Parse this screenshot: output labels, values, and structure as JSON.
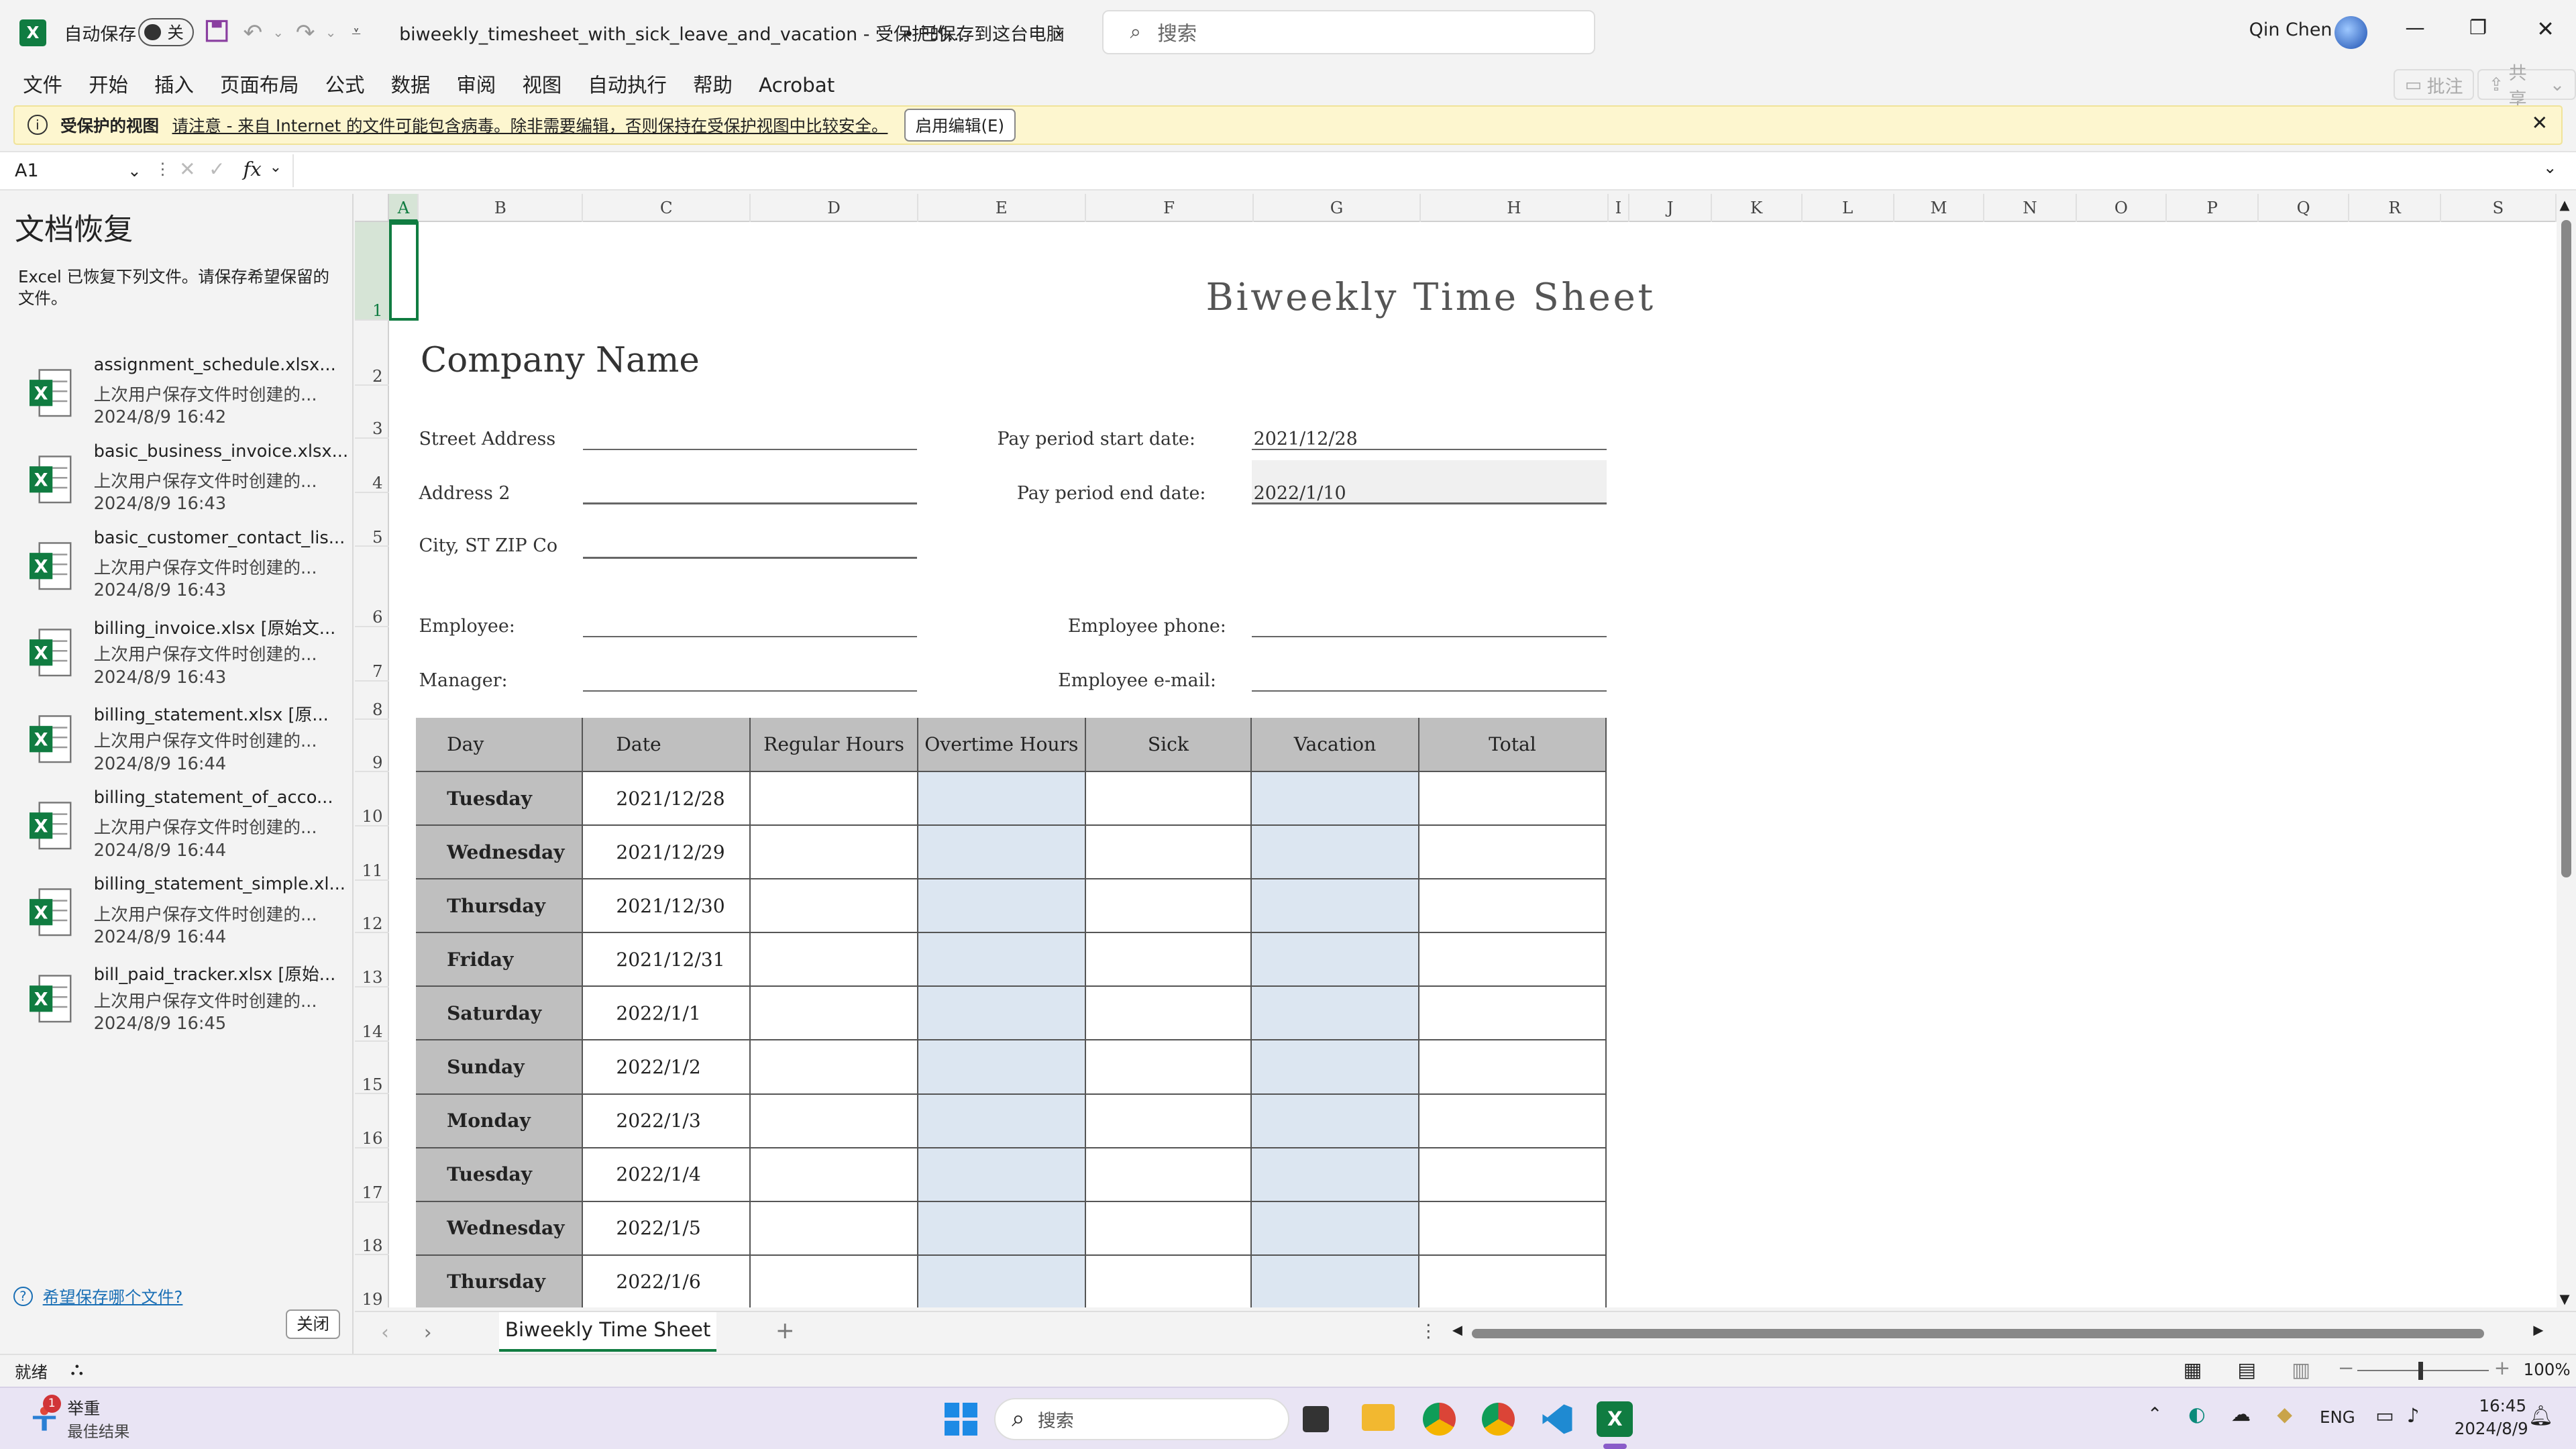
{
  "titlebar": {
    "autosave_label": "自动保存",
    "autosave_state": "关",
    "doc_title": "biweekly_timesheet_with_sick_leave_and_vacation  -  受保护的...",
    "save_status": "• 已保存到这台电脑",
    "search_placeholder": "搜索",
    "user_name": "Qin Chen"
  },
  "menu": {
    "items": [
      "文件",
      "开始",
      "插入",
      "页面布局",
      "公式",
      "数据",
      "审阅",
      "视图",
      "自动执行",
      "帮助",
      "Acrobat"
    ],
    "comments": "批注",
    "share": "共享"
  },
  "protected": {
    "label": "受保护的视图",
    "message": "请注意 - 来自 Internet 的文件可能包含病毒。除非需要编辑，否则保持在受保护视图中比较安全。",
    "enable_button": "启用编辑(E)"
  },
  "formula_bar": {
    "name_box": "A1",
    "fx": "fx",
    "formula": ""
  },
  "recovery": {
    "title": "文档恢复",
    "description": "Excel 已恢复下列文件。请保存希望保留的文件。",
    "files": [
      {
        "name": "assignment_schedule.xlsx...",
        "desc": "上次用户保存文件时创建的...",
        "time": "2024/8/9 16:42"
      },
      {
        "name": "basic_business_invoice.xlsx...",
        "desc": "上次用户保存文件时创建的...",
        "time": "2024/8/9 16:43"
      },
      {
        "name": "basic_customer_contact_lis...",
        "desc": "上次用户保存文件时创建的...",
        "time": "2024/8/9 16:43"
      },
      {
        "name": "billing_invoice.xlsx  [原始文...",
        "desc": "上次用户保存文件时创建的...",
        "time": "2024/8/9 16:43"
      },
      {
        "name": "billing_statement.xlsx  [原...",
        "desc": "上次用户保存文件时创建的...",
        "time": "2024/8/9 16:44"
      },
      {
        "name": "billing_statement_of_acco...",
        "desc": "上次用户保存文件时创建的...",
        "time": "2024/8/9 16:44"
      },
      {
        "name": "billing_statement_simple.xl...",
        "desc": "上次用户保存文件时创建的...",
        "time": "2024/8/9 16:44"
      },
      {
        "name": "bill_paid_tracker.xlsx  [原始...",
        "desc": "上次用户保存文件时创建的...",
        "time": "2024/8/9 16:45"
      }
    ],
    "help_link": "希望保存哪个文件?",
    "close_button": "关闭"
  },
  "columns": [
    "A",
    "B",
    "C",
    "D",
    "E",
    "F",
    "G",
    "H",
    "I",
    "J",
    "K",
    "L",
    "M",
    "N",
    "O",
    "P",
    "Q",
    "R",
    "S"
  ],
  "rows": [
    "1",
    "2",
    "3",
    "4",
    "5",
    "6",
    "7",
    "8",
    "9",
    "10",
    "11",
    "12",
    "13",
    "14",
    "15",
    "16",
    "17",
    "18",
    "19"
  ],
  "sheet": {
    "title": "Biweekly Time Sheet",
    "company": "Company Name",
    "street": "Street Address",
    "address2": "Address 2",
    "city": "City, ST  ZIP Co",
    "employee": "Employee:",
    "manager": "Manager:",
    "pay_start_label": "Pay period start date:",
    "pay_start": "2021/12/28",
    "pay_end_label": "Pay period end date:",
    "pay_end": "2022/1/10",
    "phone_label": "Employee phone:",
    "email_label": "Employee e-mail:",
    "headers": [
      "Day",
      "Date",
      "Regular Hours",
      "Overtime Hours",
      "Sick",
      "Vacation",
      "Total"
    ],
    "days": [
      {
        "day": "Tuesday",
        "date": "2021/12/28"
      },
      {
        "day": "Wednesday",
        "date": "2021/12/29"
      },
      {
        "day": "Thursday",
        "date": "2021/12/30"
      },
      {
        "day": "Friday",
        "date": "2021/12/31"
      },
      {
        "day": "Saturday",
        "date": "2022/1/1"
      },
      {
        "day": "Sunday",
        "date": "2022/1/2"
      },
      {
        "day": "Monday",
        "date": "2022/1/3"
      },
      {
        "day": "Tuesday",
        "date": "2022/1/4"
      },
      {
        "day": "Wednesday",
        "date": "2022/1/5"
      },
      {
        "day": "Thursday",
        "date": "2022/1/6"
      }
    ]
  },
  "tabs": {
    "active": "Biweekly Time Sheet"
  },
  "status": {
    "ready": "就绪",
    "zoom": "100%"
  },
  "taskbar": {
    "notif_title": "举重",
    "notif_sub": "最佳结果",
    "notif_badge": "1",
    "search": "搜索",
    "lang": "ENG",
    "time": "16:45",
    "date": "2024/8/9"
  },
  "colors": {
    "accent": "#107c41",
    "header_gray": "#bfbfbf",
    "blue_col": "#dce6f1"
  }
}
